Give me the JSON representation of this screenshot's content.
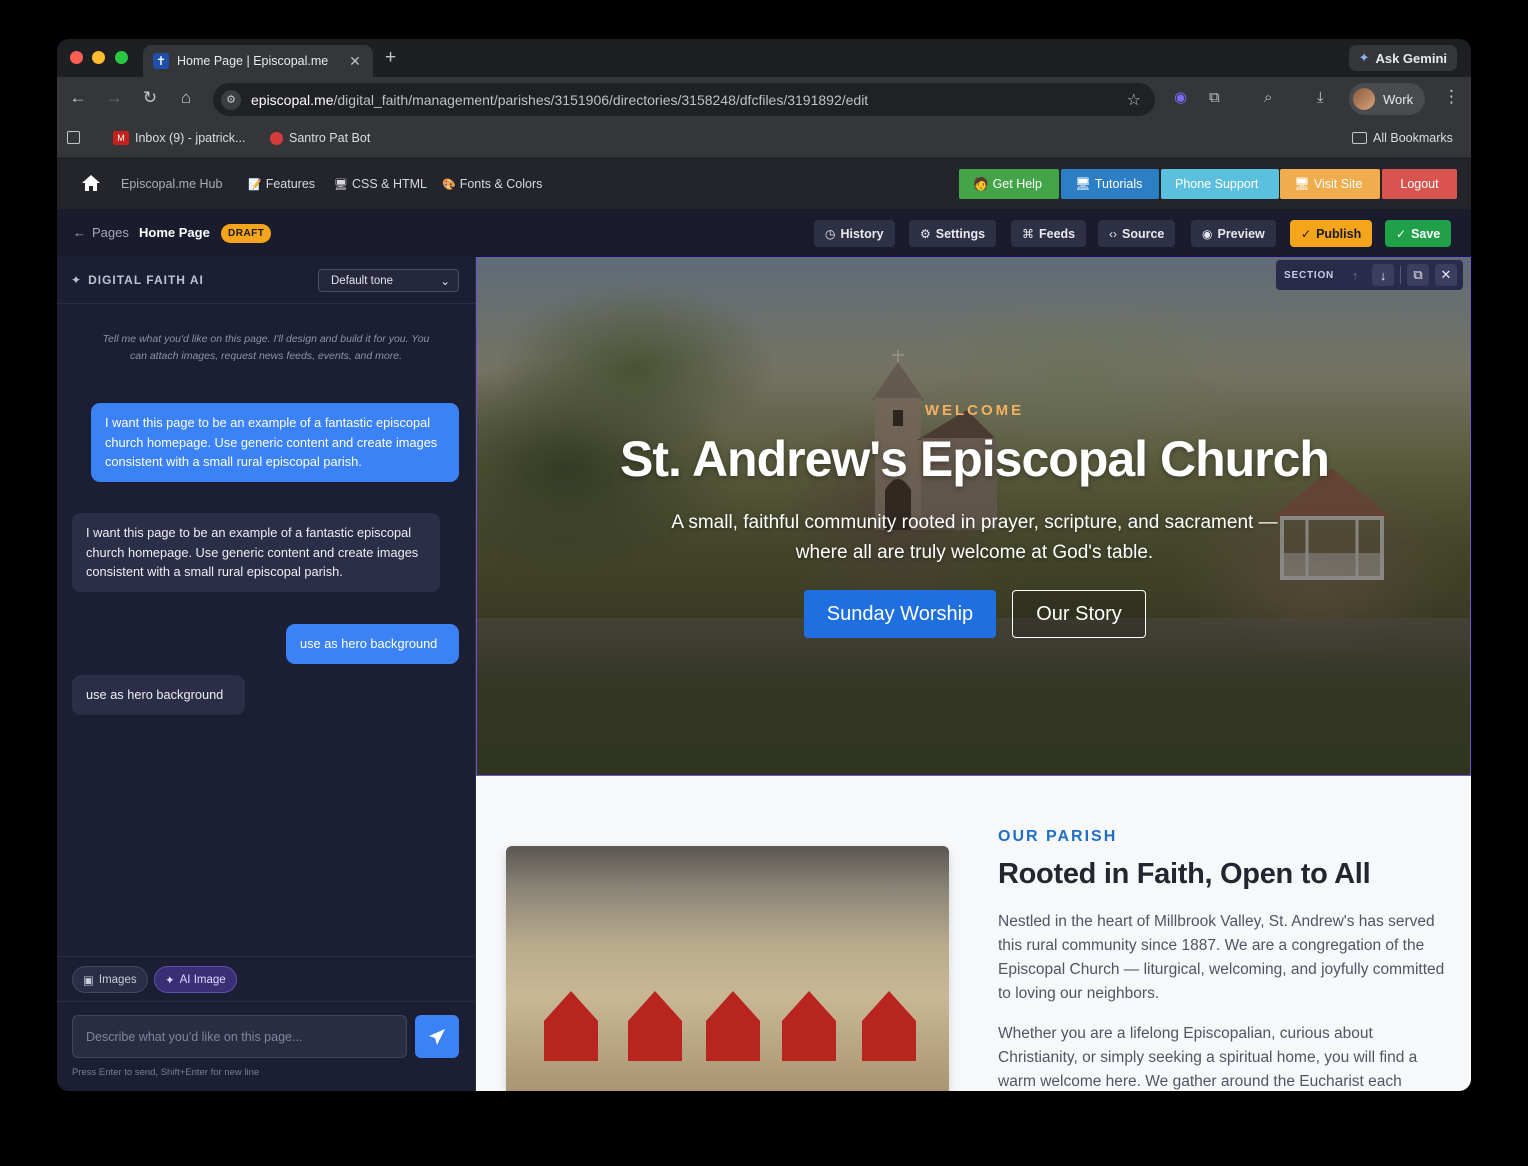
{
  "browser": {
    "tab_title": "Home Page | Episcopal.me",
    "tab_favicon": "✝",
    "ask_gemini": "Ask Gemini",
    "url_domain": "episcopal.me",
    "url_path": "/digital_faith/management/parishes/3151906/directories/3158248/dfcfiles/3191892/edit",
    "profile": "Work",
    "bookmarks": [
      "Inbox (9) - jpatrick...",
      "Santro Pat Bot"
    ],
    "all_bookmarks": "All Bookmarks",
    "colors": {
      "close": "#ff5f57",
      "minimize": "#febc2e",
      "zoom": "#28c840"
    }
  },
  "appnav": {
    "hub": "Episcopal.me Hub",
    "links": [
      {
        "icon": "📝",
        "label": "Features"
      },
      {
        "icon": "🖥",
        "label": "CSS & HTML"
      },
      {
        "icon": "🎨",
        "label": "Fonts & Colors"
      }
    ],
    "buttons": [
      {
        "icon": "🧑",
        "label": "Get Help",
        "color": "#44a548"
      },
      {
        "icon": "🖥",
        "label": "Tutorials",
        "color": "#2c7fc5"
      },
      {
        "icon": "",
        "label": "Phone Support",
        "color": "#5bc0de"
      },
      {
        "icon": "🖥",
        "label": "Visit Site",
        "color": "#f0ad4e"
      },
      {
        "icon": "",
        "label": "Logout",
        "color": "#d9534f"
      }
    ]
  },
  "editor": {
    "back_label": "Pages",
    "page_title": "Home Page",
    "status": "DRAFT",
    "actions": [
      {
        "icon": "history-icon",
        "label": "History"
      },
      {
        "icon": "gear-icon",
        "label": "Settings"
      },
      {
        "icon": "rss-icon",
        "label": "Feeds"
      },
      {
        "icon": "code-icon",
        "label": "Source"
      },
      {
        "icon": "eye-icon",
        "label": "Preview"
      }
    ],
    "publish": "Publish",
    "save": "Save",
    "publish_color": "#f4a51c",
    "save_color": "#21a04a"
  },
  "ai_panel": {
    "title": "DIGITAL FAITH AI",
    "tone": "Default tone",
    "hint": "Tell me what you'd like on this page. I'll design and build it for you. You can attach images, request news feeds, events, and more.",
    "messages": [
      {
        "role": "user",
        "text": "I want this page to be an example of a fantastic episcopal church homepage. Use generic content and create images consistent with a small rural episcopal parish."
      },
      {
        "role": "ai",
        "text": "I want this page to be an example of a fantastic episcopal church homepage. Use generic content and create images consistent with a small rural episcopal parish."
      },
      {
        "role": "user",
        "text": "use as hero background"
      },
      {
        "role": "ai",
        "text": "use as hero background"
      }
    ],
    "chip_images": "Images",
    "chip_ai_image": "AI Image",
    "input_placeholder": "Describe what you'd like on this page...",
    "press_hint": "Press Enter to send, Shift+Enter for new line"
  },
  "section_toolbar": {
    "label": "SECTION"
  },
  "hero": {
    "eyebrow": "WELCOME",
    "title": "St. Andrew's Episcopal Church",
    "subtitle": "A small, faithful community rooted in prayer, scripture, and sacrament — where all are truly welcome at God's table.",
    "primary_button": "Sunday Worship",
    "secondary_button": "Our Story"
  },
  "parish": {
    "eyebrow": "OUR PARISH",
    "title": "Rooted in Faith, Open to All",
    "paragraphs": [
      "Nestled in the heart of Millbrook Valley, St. Andrew's has served this rural community since 1887. We are a congregation of the Episcopal Church — liturgical, welcoming, and joyfully committed to loving our neighbors.",
      "Whether you are a lifelong Episcopalian, curious about Christianity, or simply seeking a spiritual home, you will find a warm welcome here. We gather around the Eucharist each"
    ]
  }
}
